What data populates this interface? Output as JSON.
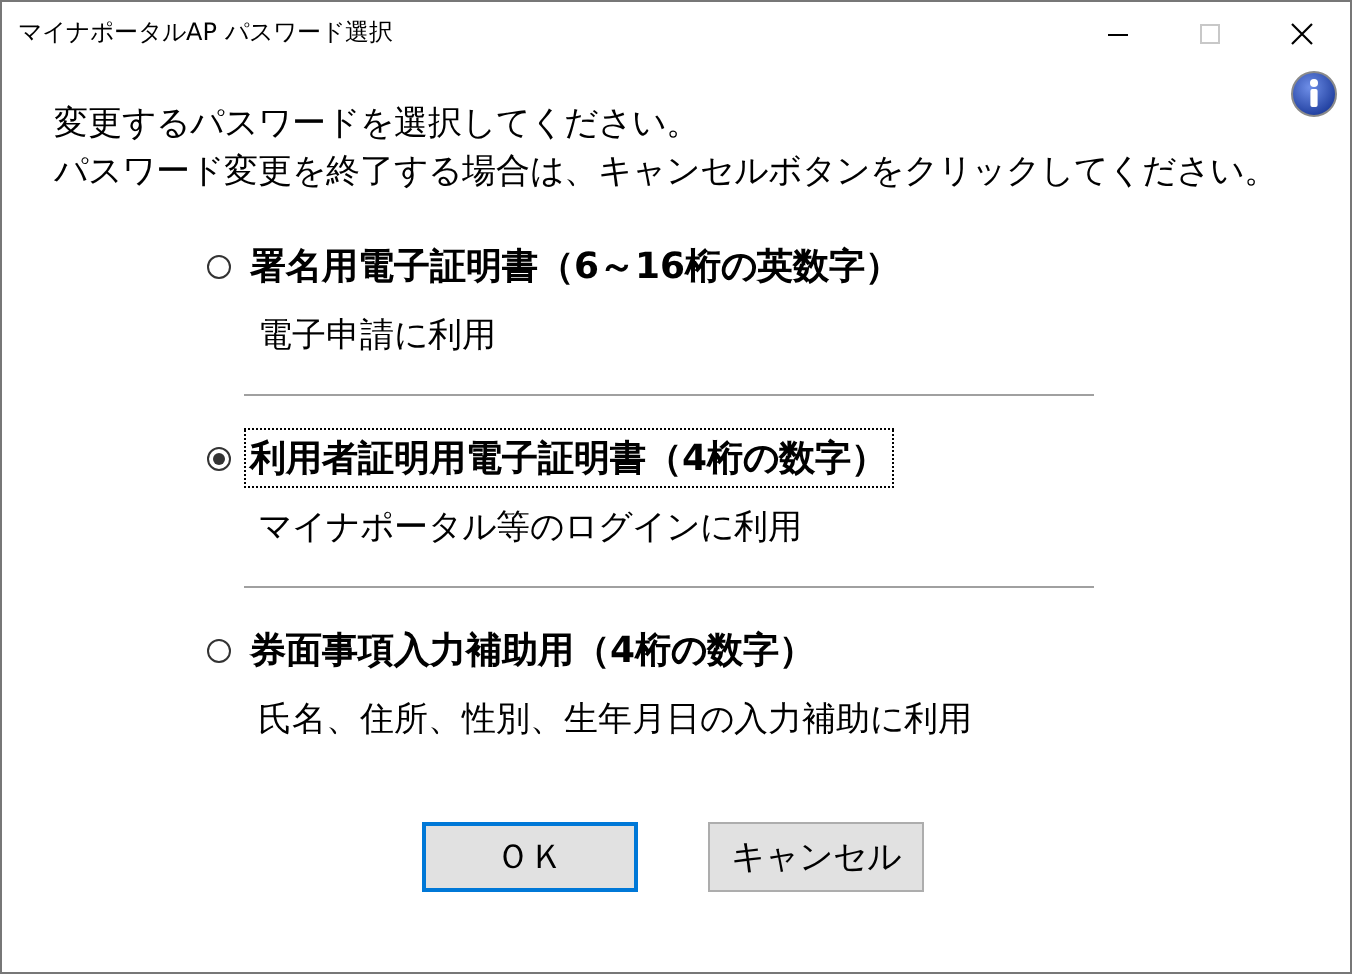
{
  "window": {
    "title": "マイナポータルAP パスワード選択"
  },
  "instructions": [
    "変更するパスワードを選択してください。",
    "パスワード変更を終了する場合は、キャンセルボタンをクリックしてください。"
  ],
  "options": [
    {
      "label": "署名用電子証明書（6～16桁の英数字）",
      "description": "電子申請に利用",
      "selected": false
    },
    {
      "label": "利用者証明用電子証明書（4桁の数字）",
      "description": "マイナポータル等のログインに利用",
      "selected": true
    },
    {
      "label": "券面事項入力補助用（4桁の数字）",
      "description": "氏名、住所、性別、生年月日の入力補助に利用",
      "selected": false
    }
  ],
  "buttons": [
    {
      "label": "ＯＫ",
      "default": true
    },
    {
      "label": "キャンセル",
      "default": false
    }
  ]
}
